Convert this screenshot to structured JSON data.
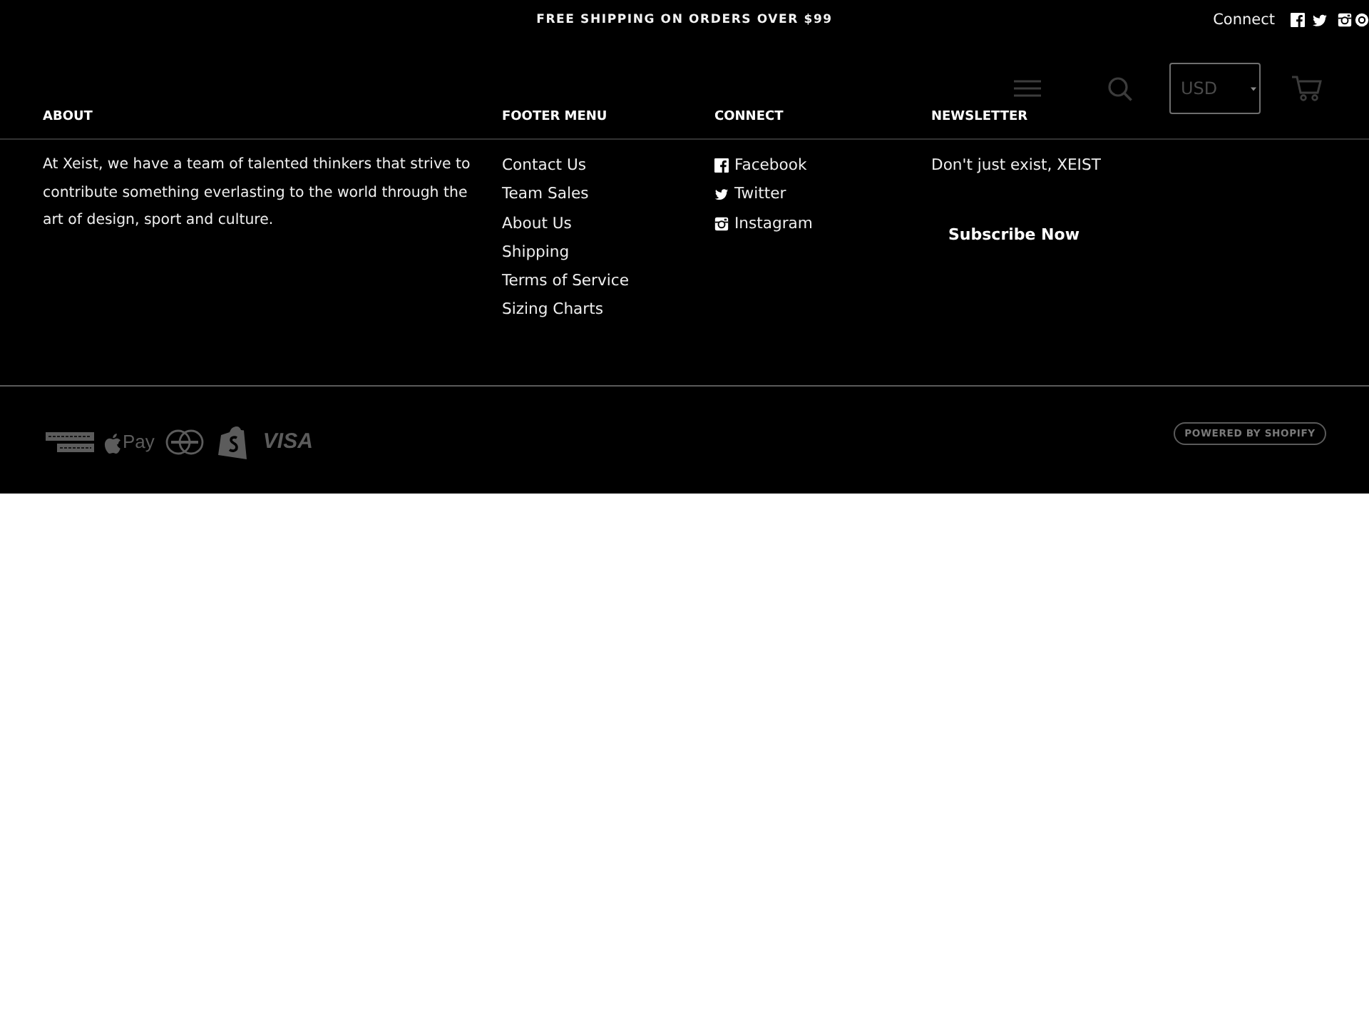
{
  "announcement_bar": {
    "text": "FREE SHIPPING ON ORDERS OVER $99",
    "connect_label": "Connect"
  },
  "header": {
    "currency": "USD"
  },
  "footer": {
    "about": {
      "heading": "ABOUT",
      "text": "At Xeist, we have a team of talented thinkers that strive to contribute something everlasting to the world through the art of design, sport and culture."
    },
    "menu": {
      "heading": "FOOTER MENU",
      "links": [
        "Contact Us",
        "Team Sales",
        "About Us",
        "Shipping",
        "Terms of Service",
        "Sizing Charts"
      ]
    },
    "connect": {
      "heading": "CONNECT",
      "links": [
        {
          "kind": "facebook",
          "label": "Facebook"
        },
        {
          "kind": "twitter",
          "label": "Twitter"
        },
        {
          "kind": "instagram",
          "label": "Instagram"
        }
      ]
    },
    "newsletter": {
      "heading": "NEWSLETTER",
      "text": "Don't just exist, XEIST",
      "button": "Subscribe Now"
    },
    "payment_methods": [
      {
        "kind": "amex"
      },
      {
        "kind": "apple_pay",
        "label": "Pay"
      },
      {
        "kind": "mastercard"
      },
      {
        "kind": "shopify"
      },
      {
        "kind": "visa",
        "label": "VISA"
      }
    ],
    "powered_by": "POWERED BY SHOPIFY"
  }
}
